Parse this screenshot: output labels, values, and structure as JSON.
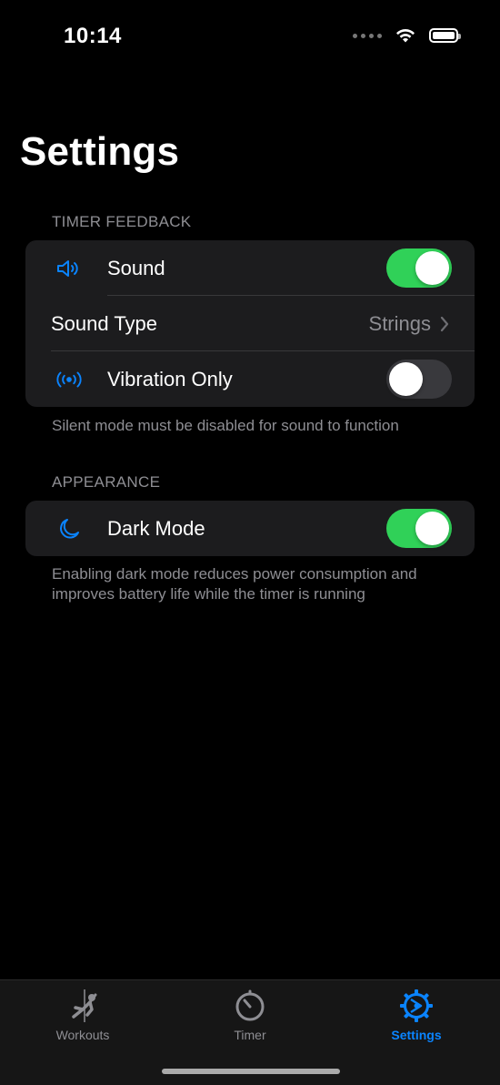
{
  "status_bar": {
    "time": "10:14",
    "wifi_icon": "wifi-icon",
    "battery_icon": "battery-icon"
  },
  "page": {
    "title": "Settings"
  },
  "timer_feedback": {
    "header": "TIMER FEEDBACK",
    "footer": "Silent mode must be disabled for sound to function",
    "rows": [
      {
        "icon": "speaker-icon",
        "label": "Sound",
        "toggle": true
      },
      {
        "label": "Sound Type",
        "value": "Strings",
        "icon": "chevron-right-icon"
      },
      {
        "icon": "vibration-icon",
        "label": "Vibration Only",
        "toggle": false
      }
    ]
  },
  "appearance": {
    "header": "APPEARANCE",
    "footer": "Enabling dark mode reduces power consumption and improves battery life while the timer is running",
    "rows": [
      {
        "icon": "moon-icon",
        "label": "Dark Mode",
        "toggle": true
      }
    ]
  },
  "tab_bar": {
    "tabs": [
      {
        "label": "Workouts",
        "icon": "climber-icon",
        "active": false
      },
      {
        "label": "Timer",
        "icon": "timer-icon",
        "active": false
      },
      {
        "label": "Settings",
        "icon": "gear-icon",
        "active": true
      }
    ]
  },
  "colors": {
    "accent": "#0a84ff",
    "toggle_on": "#30d158",
    "toggle_off": "#39393d",
    "group_bg": "#1c1c1e",
    "secondary_text": "#8e8e93"
  }
}
